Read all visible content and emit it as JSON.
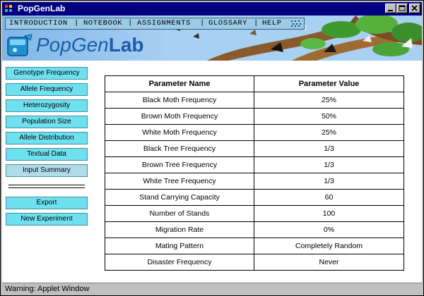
{
  "window": {
    "title": "PopGenLab"
  },
  "nav": {
    "items": [
      "INTRODUCTION",
      "NOTEBOOK",
      "ASSIGNMENTS",
      "GLOSSARY",
      "HELP"
    ]
  },
  "logo": {
    "text_pop": "PopGen",
    "text_lab": "Lab"
  },
  "sidebar": {
    "items": [
      {
        "label": "Genotype Frequency",
        "selected": false
      },
      {
        "label": "Allele Frequency",
        "selected": false
      },
      {
        "label": "Heterozygosity",
        "selected": false
      },
      {
        "label": "Population Size",
        "selected": false
      },
      {
        "label": "Allele Distribution",
        "selected": false
      },
      {
        "label": "Textual Data",
        "selected": false
      },
      {
        "label": "Input Summary",
        "selected": true
      }
    ],
    "actions": [
      {
        "label": "Export"
      },
      {
        "label": "New Experiment"
      }
    ]
  },
  "table": {
    "headers": [
      "Parameter Name",
      "Parameter Value"
    ],
    "rows": [
      [
        "Black Moth Frequency",
        "25%"
      ],
      [
        "Brown Moth Frequency",
        "50%"
      ],
      [
        "White Moth Frequency",
        "25%"
      ],
      [
        "Black Tree Frequency",
        "1/3"
      ],
      [
        "Brown Tree Frequency",
        "1/3"
      ],
      [
        "White Tree Frequency",
        "1/3"
      ],
      [
        "Stand Carrying Capacity",
        "60"
      ],
      [
        "Number of Stands",
        "100"
      ],
      [
        "Migration Rate",
        "0%"
      ],
      [
        "Mating Pattern",
        "Completely Random"
      ],
      [
        "Disaster Frequency",
        "Never"
      ]
    ]
  },
  "status": {
    "text": "Warning: Applet Window"
  },
  "colors": {
    "titlebar": "#000080",
    "sidebar_button": "#6fe0f0",
    "sidebar_button_selected": "#b0dcea",
    "logo_text": "#1a5da8"
  }
}
